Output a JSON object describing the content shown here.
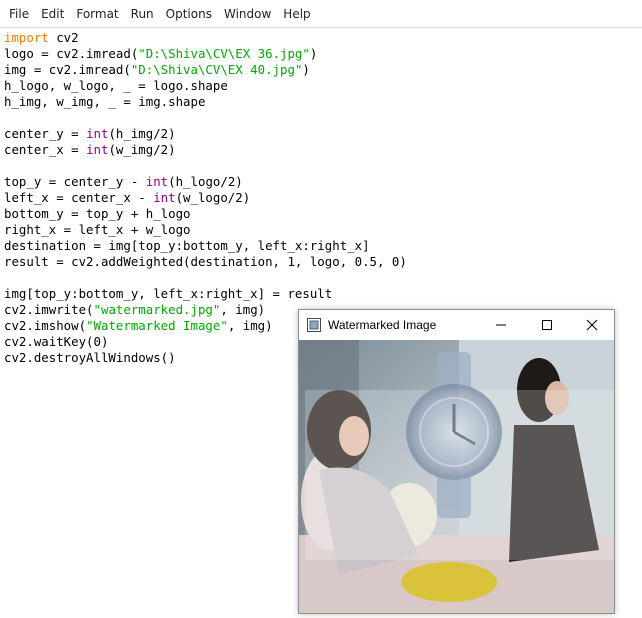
{
  "menubar": {
    "items": [
      "File",
      "Edit",
      "Format",
      "Run",
      "Options",
      "Window",
      "Help"
    ]
  },
  "editor": {
    "lines": [
      [
        {
          "t": "import",
          "c": "kw"
        },
        {
          "t": " cv2",
          "c": ""
        }
      ],
      [
        {
          "t": "logo = cv2.imread(",
          "c": ""
        },
        {
          "t": "\"D:\\Shiva\\CV\\EX 36.jpg\"",
          "c": "st"
        },
        {
          "t": ")",
          "c": ""
        }
      ],
      [
        {
          "t": "img = cv2.imread(",
          "c": ""
        },
        {
          "t": "\"D:\\Shiva\\CV\\EX 40.jpg\"",
          "c": "st"
        },
        {
          "t": ")",
          "c": ""
        }
      ],
      [
        {
          "t": "h_logo, w_logo, _ = logo.shape",
          "c": ""
        }
      ],
      [
        {
          "t": "h_img, w_img, _ = img.shape",
          "c": ""
        }
      ],
      [],
      [
        {
          "t": "center_y = ",
          "c": ""
        },
        {
          "t": "int",
          "c": "bi"
        },
        {
          "t": "(h_img/2)",
          "c": ""
        }
      ],
      [
        {
          "t": "center_x = ",
          "c": ""
        },
        {
          "t": "int",
          "c": "bi"
        },
        {
          "t": "(w_img/2)",
          "c": ""
        }
      ],
      [],
      [
        {
          "t": "top_y = center_y - ",
          "c": ""
        },
        {
          "t": "int",
          "c": "bi"
        },
        {
          "t": "(h_logo/2)",
          "c": ""
        }
      ],
      [
        {
          "t": "left_x = center_x - ",
          "c": ""
        },
        {
          "t": "int",
          "c": "bi"
        },
        {
          "t": "(w_logo/2)",
          "c": ""
        }
      ],
      [
        {
          "t": "bottom_y = top_y + h_logo",
          "c": ""
        }
      ],
      [
        {
          "t": "right_x = left_x + w_logo",
          "c": ""
        }
      ],
      [
        {
          "t": "destination = img[top_y:bottom_y, left_x:right_x]",
          "c": ""
        }
      ],
      [
        {
          "t": "result = cv2.addWeighted(destination, 1, logo, 0.5, 0)",
          "c": ""
        }
      ],
      [],
      [
        {
          "t": "img[top_y:bottom_y, left_x:right_x] = result",
          "c": ""
        }
      ],
      [
        {
          "t": "cv2.imwrite(",
          "c": ""
        },
        {
          "t": "\"watermarked.jpg\"",
          "c": "st"
        },
        {
          "t": ", img)",
          "c": ""
        }
      ],
      [
        {
          "t": "cv2.imshow(",
          "c": ""
        },
        {
          "t": "\"Watermarked Image\"",
          "c": "st"
        },
        {
          "t": ", img)",
          "c": ""
        }
      ],
      [
        {
          "t": "cv2.waitKey(0)",
          "c": ""
        }
      ],
      [
        {
          "t": "cv2.destroyAllWindows()",
          "c": ""
        }
      ]
    ]
  },
  "image_window": {
    "title": "Watermarked Image",
    "icons": [
      "app-icon",
      "minimize-icon",
      "maximize-icon",
      "close-icon"
    ]
  }
}
